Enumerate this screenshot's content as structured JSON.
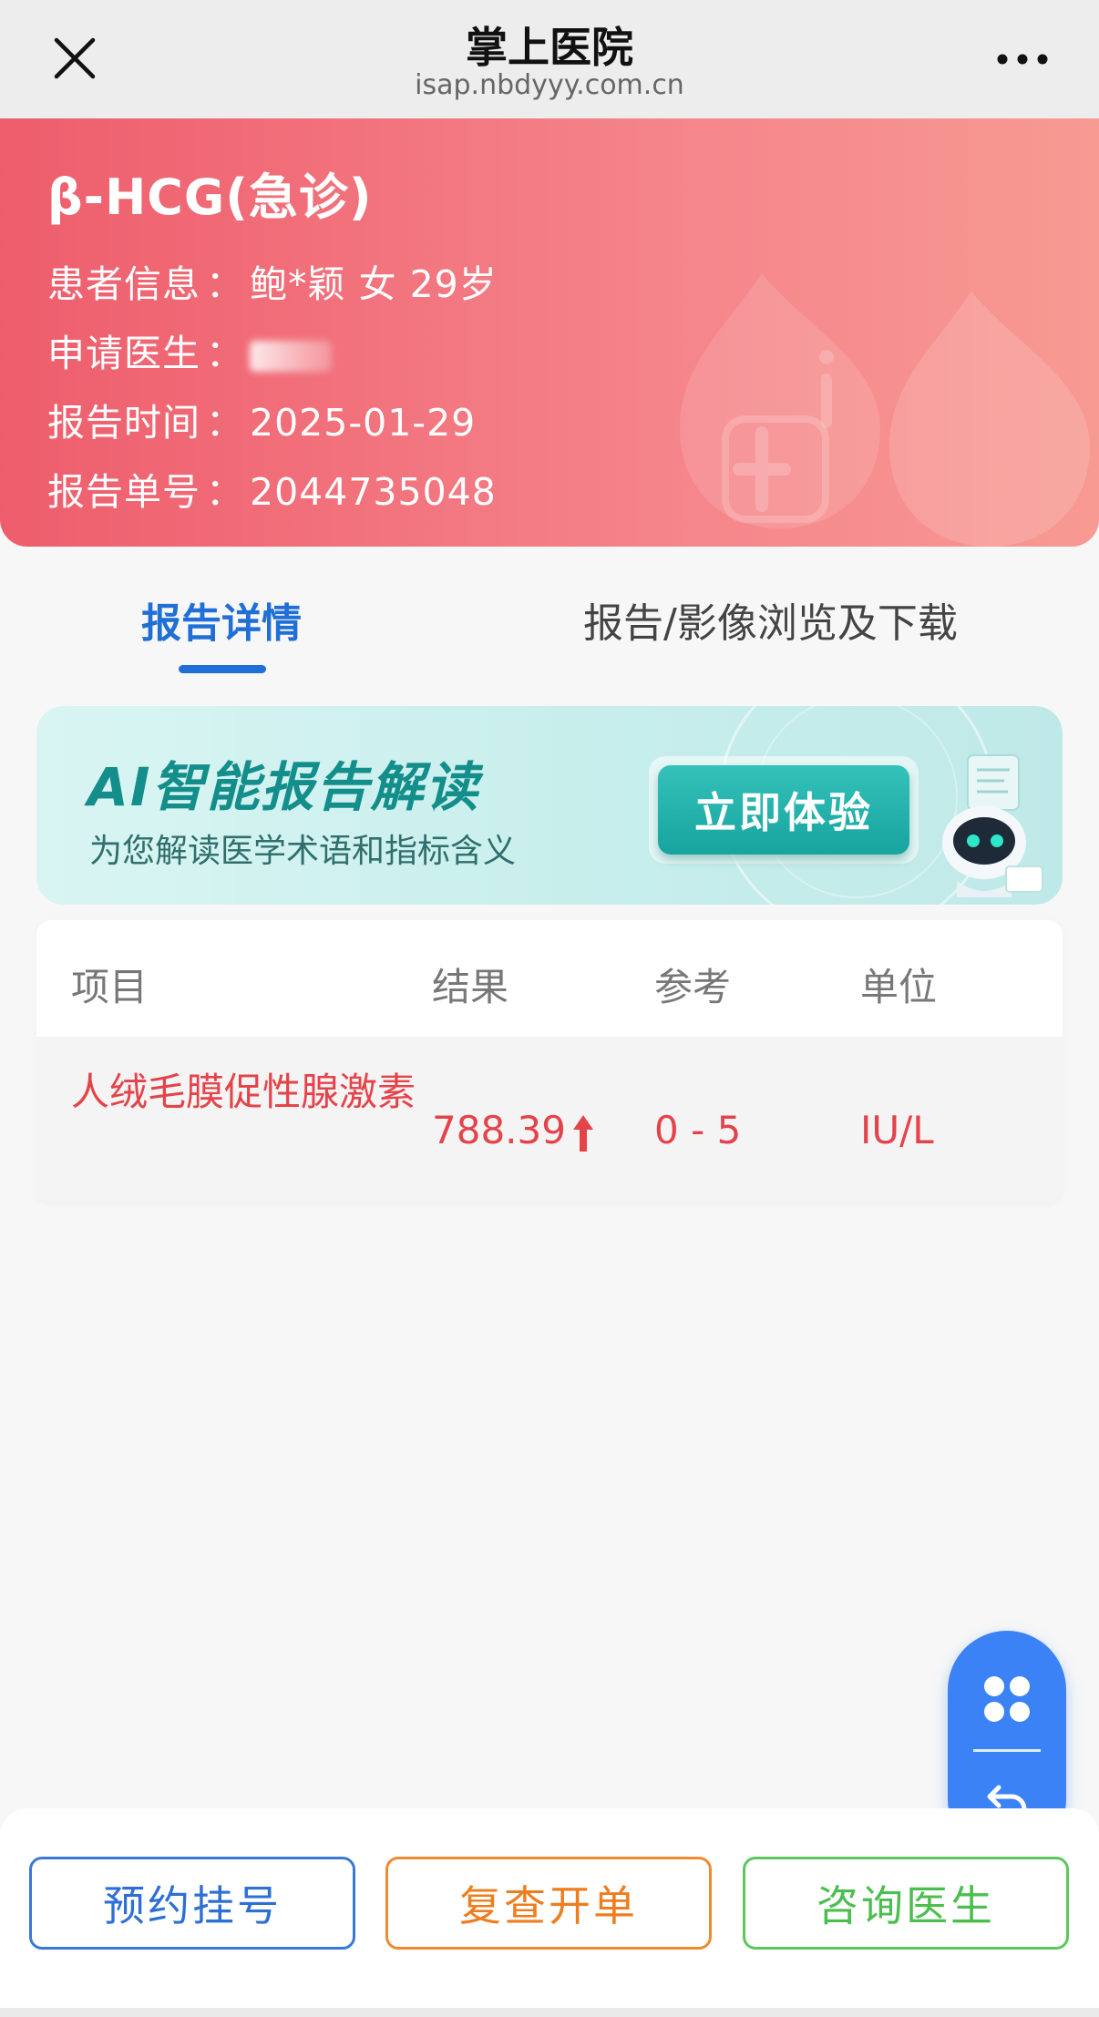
{
  "nav": {
    "title": "掌上医院",
    "url": "isap.nbdyyy.com.cn"
  },
  "report": {
    "title": "β-HCG(急诊)",
    "separator": "：",
    "patient_label": "患者信息",
    "patient_value": "鲍*颖 女 29岁",
    "doctor_label": "申请医生",
    "time_label": "报告时间",
    "time_value": "2025-01-29",
    "number_label": "报告单号",
    "number_value": "2044735048"
  },
  "tabs": [
    {
      "label": "报告详情",
      "active": true
    },
    {
      "label": "报告/影像浏览及下载",
      "active": false
    }
  ],
  "ai_banner": {
    "title": "AI智能报告解读",
    "subtitle": "为您解读医学术语和指标含义",
    "button": "立即体验"
  },
  "table": {
    "headers": [
      "项目",
      "结果",
      "参考",
      "单位"
    ],
    "rows": [
      {
        "item": "人绒毛膜促性腺激素",
        "result": "788.39",
        "reference": "0 - 5",
        "unit": "IU/L",
        "flag": "high"
      }
    ]
  },
  "actions": {
    "appoint": "预约挂号",
    "recheck": "复查开单",
    "consult": "咨询医生"
  },
  "colors": {
    "header_gradient_start": "#ee5d6c",
    "header_gradient_end": "#f79a92",
    "accent_blue": "#1f6fd6",
    "abnormal_red": "#e5434a",
    "fab_blue": "#3b82f6",
    "btn_orange": "#ee7d1e",
    "btn_green": "#4cbe4f",
    "ai_teal": "#138e8b"
  },
  "icons": {
    "nav_close": "close-icon",
    "nav_more": "more-dots-icon",
    "fab_menu": "four-petal-menu-icon",
    "fab_back": "undo-back-icon",
    "result_flag": "arrow-up-icon"
  }
}
